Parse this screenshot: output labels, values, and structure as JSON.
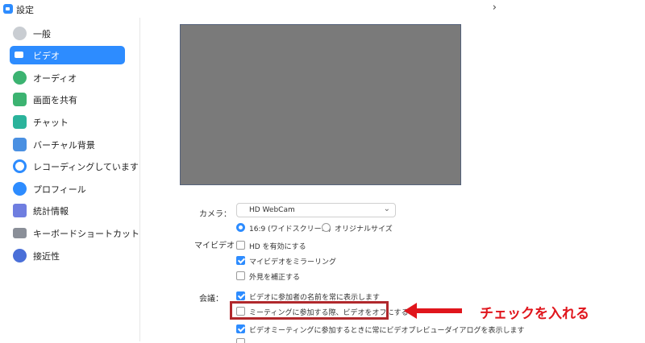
{
  "window": {
    "title": "設定",
    "chevron": "›"
  },
  "sidebar": {
    "items": [
      {
        "label": "一般",
        "icon": "gear-icon",
        "color": "#c9cdd2"
      },
      {
        "label": "ビデオ",
        "icon": "video-camera-icon",
        "color": "#ffffff",
        "active": true
      },
      {
        "label": "オーディオ",
        "icon": "headphones-icon",
        "color": "#3cb371"
      },
      {
        "label": "画面を共有",
        "icon": "share-screen-icon",
        "color": "#3cb371"
      },
      {
        "label": "チャット",
        "icon": "chat-bubble-icon",
        "color": "#2bb39b"
      },
      {
        "label": "バーチャル背景",
        "icon": "person-background-icon",
        "color": "#4a90e2"
      },
      {
        "label": "レコーディングしています",
        "icon": "record-icon",
        "color": "#2d8cff"
      },
      {
        "label": "プロフィール",
        "icon": "profile-icon",
        "color": "#2d8cff"
      },
      {
        "label": "統計情報",
        "icon": "statistics-icon",
        "color": "#6f7ee0"
      },
      {
        "label": "キーボードショートカット",
        "icon": "keyboard-icon",
        "color": "#8a8f98"
      },
      {
        "label": "接近性",
        "icon": "accessibility-icon",
        "color": "#4a6fd8"
      }
    ]
  },
  "video": {
    "camera_label": "カメラ：",
    "camera_value": "HD WebCam",
    "aspect_16_9": "16:9 (ワイドスクリーン)",
    "aspect_original": "オリジナルサイズ",
    "my_video_label": "マイビデオ",
    "hd_label": "HD を有効にする",
    "mirror_label": "マイビデオをミラーリング",
    "touch_up_label": "外見を補正する",
    "meeting_label": "会議：",
    "show_names_label": "ビデオに参加者の名前を常に表示します",
    "turn_off_video_label": "ミーティングに参加する際、ビデオをオフにする",
    "preview_dialog_label": "ビデオミーティングに参加するときに常にビデオプレビューダイアログを表示します"
  },
  "annotation": {
    "text": "チェックを入れる",
    "color": "#e0151c"
  },
  "colors": {
    "accent": "#2d8cff",
    "highlight": "#b0282c"
  }
}
